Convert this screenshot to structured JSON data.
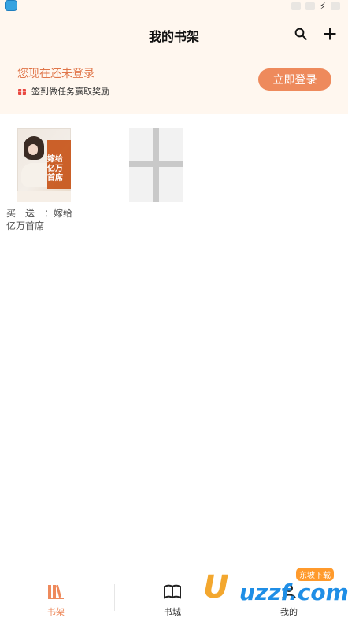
{
  "header": {
    "title": "我的书架",
    "search_icon": "search-icon",
    "add_icon": "plus-icon"
  },
  "login_banner": {
    "prompt": "您现在还未登录",
    "reward_text": "签到做任务赢取奖励",
    "button_label": "立即登录",
    "accent_color": "#e0764a",
    "button_color": "#ee8a5c"
  },
  "shelf": {
    "books": [
      {
        "title": "买一送一：嫁给亿万首席",
        "cover_text": "嫁给亿万首席"
      }
    ],
    "add_slot_icon": "plus-icon"
  },
  "tabbar": {
    "tabs": [
      {
        "label": "书架",
        "icon": "bookshelf-icon",
        "active": true
      },
      {
        "label": "书城",
        "icon": "open-book-icon",
        "active": false
      },
      {
        "label": "我的",
        "icon": "user-icon",
        "active": false
      }
    ]
  },
  "watermark": {
    "brand": "uzzf.com",
    "badge": "东坡下载"
  }
}
